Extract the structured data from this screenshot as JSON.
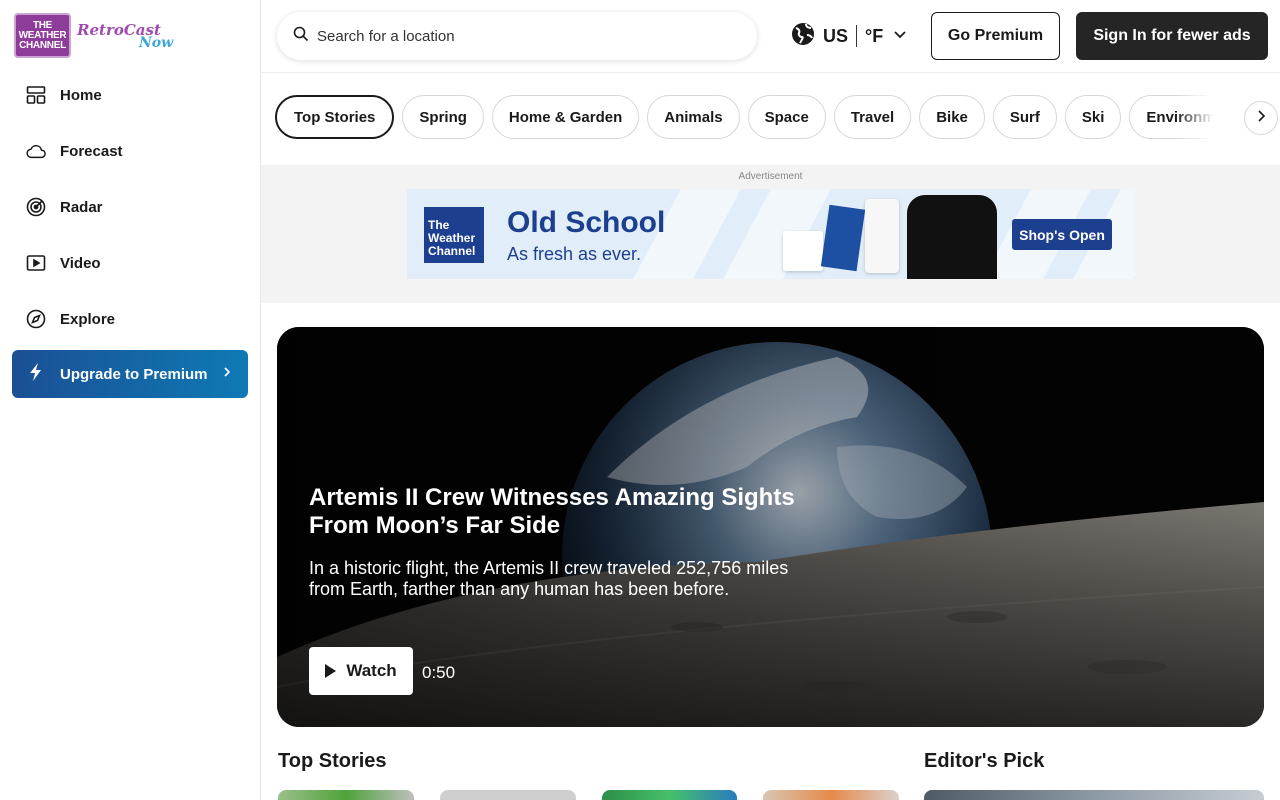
{
  "brand": {
    "logo_line1": "THE",
    "logo_line2": "WEATHER",
    "logo_line3": "CHANNEL",
    "retro": "RetroCast",
    "now": "Now"
  },
  "sidebar": {
    "items": [
      {
        "label": "Home",
        "icon": "home-icon"
      },
      {
        "label": "Forecast",
        "icon": "cloud-icon"
      },
      {
        "label": "Radar",
        "icon": "radar-icon"
      },
      {
        "label": "Video",
        "icon": "video-icon"
      },
      {
        "label": "Explore",
        "icon": "compass-icon"
      }
    ],
    "premium_label": "Upgrade to Premium"
  },
  "header": {
    "search_placeholder": "Search for a location",
    "region": "US",
    "unit": "°F",
    "go_premium": "Go Premium",
    "sign_in": "Sign In for fewer ads"
  },
  "chips": [
    "Top Stories",
    "Spring",
    "Home & Garden",
    "Animals",
    "Space",
    "Travel",
    "Bike",
    "Surf",
    "Ski",
    "Environment"
  ],
  "ad": {
    "label": "Advertisement",
    "brand_line1": "The",
    "brand_line2": "Weather",
    "brand_line3": "Channel",
    "headline": "Old School",
    "subline": "As fresh as ever.",
    "cta": "Shop's Open"
  },
  "hero": {
    "title": "Artemis II Crew Witnesses Amazing Sights From Moon’s Far Side",
    "description": "In a historic flight, the Artemis II crew traveled 252,756 miles from Earth, farther than any human has been before.",
    "watch_label": "Watch",
    "duration": "0:50"
  },
  "sections": {
    "top_stories": "Top Stories",
    "editors_pick": "Editor's Pick"
  },
  "colors": {
    "premium_start": "#1b4f94",
    "premium_end": "#0e7ab5",
    "sign_in_bg": "#252525",
    "ad_blue": "#1d3f8f"
  }
}
